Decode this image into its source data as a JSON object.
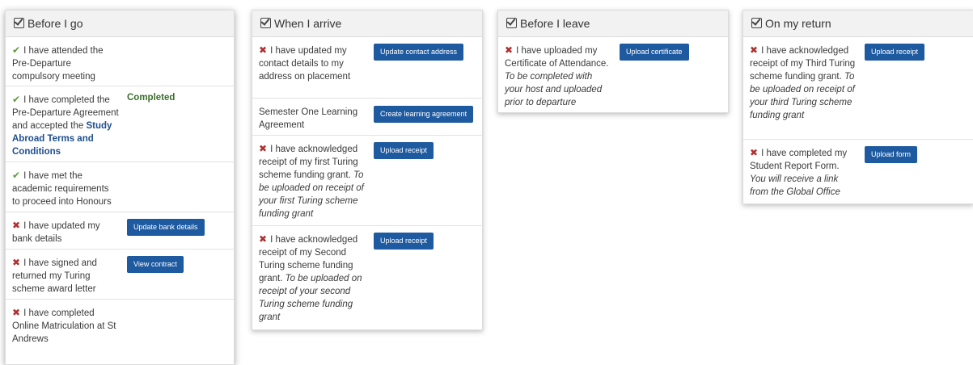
{
  "columns": {
    "before_go": {
      "title": "Before I go",
      "items": [
        {
          "status": "✔",
          "text": "I have attended the Pre-Departure compulsory meeting"
        },
        {
          "status": "✔",
          "text": "I have completed the Pre-Departure Agreement and accepted the",
          "link": "Study Abroad Terms and Conditions",
          "badge": "Completed"
        },
        {
          "status": "✔",
          "text": "I have met the academic requirements to proceed into Honours"
        },
        {
          "status": "✖",
          "text": "I have updated my bank details",
          "button": "Update bank details"
        },
        {
          "status": "✖",
          "text": "I have signed and returned my Turing scheme award letter",
          "button": "View contract"
        },
        {
          "status": "✖",
          "text": "I have completed Online Matriculation at St Andrews"
        }
      ]
    },
    "arrive": {
      "title": "When I arrive",
      "items": [
        {
          "status": "✖",
          "text": "I have updated my contact details to my address on placement",
          "button": "Update contact address"
        },
        {
          "status": "",
          "text": "Semester One Learning Agreement",
          "button": "Create learning agreement"
        },
        {
          "status": "✖",
          "text": "I have acknowledged receipt of my first Turing scheme funding grant.",
          "note": "To be uploaded on receipt of your first Turing scheme funding grant",
          "button": "Upload receipt"
        },
        {
          "status": "✖",
          "text": "I have acknowledged receipt of my Second Turing scheme funding grant.",
          "note": "To be uploaded on receipt of your second Turing scheme funding grant",
          "button": "Upload receipt"
        }
      ]
    },
    "leave": {
      "title": "Before I leave",
      "items": [
        {
          "status": "✖",
          "text": "I have uploaded my Certificate of Attendance.",
          "note": "To be completed with your host and uploaded prior to departure",
          "button": "Upload certificate"
        }
      ]
    },
    "return": {
      "title": "On my return",
      "items": [
        {
          "status": "✖",
          "text": "I have acknowledged receipt of my Third Turing scheme funding grant.",
          "note": "To be uploaded on receipt of your third Turing scheme funding grant",
          "button": "Upload receipt"
        },
        {
          "status": "✖",
          "text": "I have completed my Student Report Form.",
          "note": "You will receive a link from the Global Office",
          "button": "Upload form"
        }
      ]
    }
  },
  "colors": {
    "tick": "#5a9a38",
    "cross": "#b03030",
    "button": "#1e5aa0",
    "link": "#1f4e8c",
    "completed": "#3b6d2b"
  },
  "icons": {
    "header": "checkbox-checked-icon",
    "done": "check-icon",
    "todo": "cross-icon"
  }
}
